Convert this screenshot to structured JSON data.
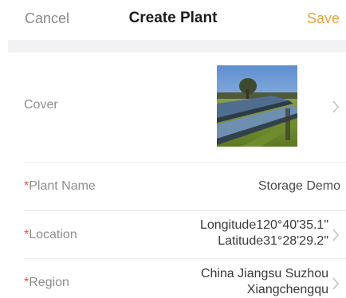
{
  "nav": {
    "cancel_label": "Cancel",
    "title": "Create Plant",
    "save_label": "Save"
  },
  "form": {
    "cover": {
      "label": "Cover"
    },
    "plant_name": {
      "required_mark": "*",
      "label": "Plant Name",
      "value": "Storage Demo"
    },
    "location": {
      "required_mark": "*",
      "label": "Location",
      "longitude": "Longitude120°40'35.1\"",
      "latitude": "Latitude31°28'29.2\""
    },
    "region": {
      "required_mark": "*",
      "label": "Region",
      "line1": "China Jiangsu Suzhou",
      "line2": "Xiangchengqu"
    }
  },
  "colors": {
    "accent": "#e8a33c",
    "required": "#e0533c",
    "label_gray": "#8e8e8e",
    "gap_gray": "#f2f2f4"
  }
}
